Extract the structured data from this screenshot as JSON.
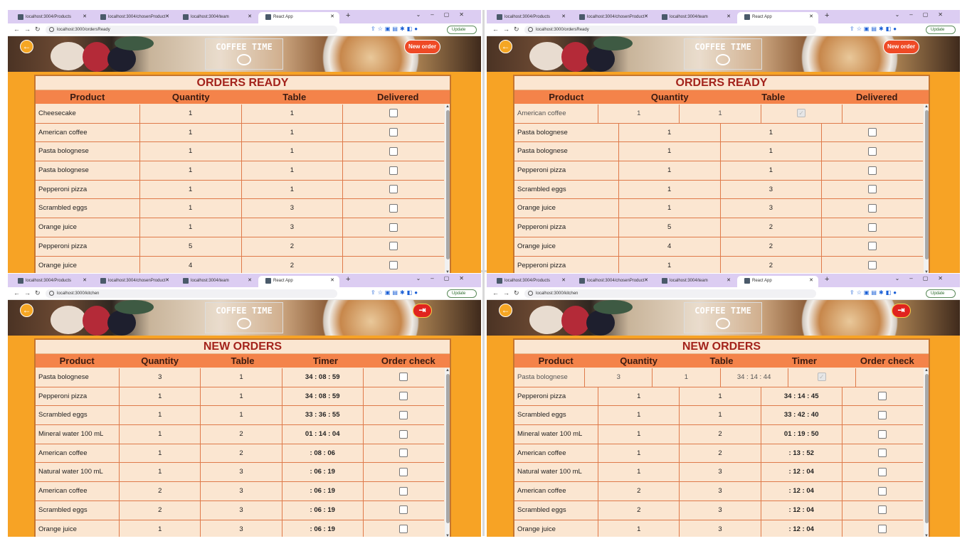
{
  "browser": {
    "tabs": [
      "localhost:3004/Products",
      "localhost:3004/chosenProduct",
      "localhost:3004/team",
      "React App"
    ],
    "update_label": "Update"
  },
  "logo_text": "COFFEE TIME",
  "top_left": {
    "url": "localhost:3000/ordersReady",
    "new_order_label": "New order",
    "title": "ORDERS READY",
    "headers": [
      "Product",
      "Quantity",
      "Table",
      "Delivered"
    ],
    "rows": [
      [
        "Cheesecake",
        "1",
        "1"
      ],
      [
        "American coffee",
        "1",
        "1"
      ],
      [
        "Pasta bolognese",
        "1",
        "1"
      ],
      [
        "Pasta bolognese",
        "1",
        "1"
      ],
      [
        "Pepperoni pizza",
        "1",
        "1"
      ],
      [
        "Scrambled eggs",
        "1",
        "3"
      ],
      [
        "Orange juice",
        "1",
        "3"
      ],
      [
        "Pepperoni pizza",
        "5",
        "2"
      ],
      [
        "Orange juice",
        "4",
        "2"
      ]
    ]
  },
  "top_right": {
    "url": "localhost:3000/ordersReady",
    "new_order_label": "New order",
    "title": "ORDERS READY",
    "headers": [
      "Product",
      "Quantity",
      "Table",
      "Delivered"
    ],
    "done_row": [
      "American coffee",
      "1",
      "1"
    ],
    "rows": [
      [
        "Pasta bolognese",
        "1",
        "1"
      ],
      [
        "Pasta bolognese",
        "1",
        "1"
      ],
      [
        "Pepperoni pizza",
        "1",
        "1"
      ],
      [
        "Scrambled eggs",
        "1",
        "3"
      ],
      [
        "Orange juice",
        "1",
        "3"
      ],
      [
        "Pepperoni pizza",
        "5",
        "2"
      ],
      [
        "Orange juice",
        "4",
        "2"
      ],
      [
        "Pepperoni pizza",
        "1",
        "2"
      ]
    ]
  },
  "bottom_left": {
    "url": "localhost:3000/kitchen",
    "title": "NEW ORDERS",
    "headers": [
      "Product",
      "Quantity",
      "Table",
      "Timer",
      "Order check"
    ],
    "rows": [
      [
        "Pasta bolognese",
        "3",
        "1",
        "34 : 08 : 59"
      ],
      [
        "Pepperoni pizza",
        "1",
        "1",
        "34 : 08 : 59"
      ],
      [
        "Scrambled eggs",
        "1",
        "1",
        "33 : 36 : 55"
      ],
      [
        "Mineral water 100 mL",
        "1",
        "2",
        "01 : 14 : 04"
      ],
      [
        "American coffee",
        "1",
        "2",
        ": 08 : 06"
      ],
      [
        "Natural water 100 mL",
        "1",
        "3",
        ": 06 : 19"
      ],
      [
        "American coffee",
        "2",
        "3",
        ": 06 : 19"
      ],
      [
        "Scrambled eggs",
        "2",
        "3",
        ": 06 : 19"
      ],
      [
        "Orange juice",
        "1",
        "3",
        ": 06 : 19"
      ]
    ]
  },
  "bottom_right": {
    "url": "localhost:3000/kitchen",
    "title": "NEW ORDERS",
    "headers": [
      "Product",
      "Quantity",
      "Table",
      "Timer",
      "Order check"
    ],
    "done_row": [
      "Pasta bolognese",
      "3",
      "1",
      "34 : 14 : 44"
    ],
    "rows": [
      [
        "Pepperoni pizza",
        "1",
        "1",
        "34 : 14 : 45"
      ],
      [
        "Scrambled eggs",
        "1",
        "1",
        "33 : 42 : 40"
      ],
      [
        "Mineral water 100 mL",
        "1",
        "2",
        "01 : 19 : 50"
      ],
      [
        "American coffee",
        "1",
        "2",
        ": 13 : 52"
      ],
      [
        "Natural water 100 mL",
        "1",
        "3",
        ": 12 : 04"
      ],
      [
        "American coffee",
        "2",
        "3",
        ": 12 : 04"
      ],
      [
        "Scrambled eggs",
        "2",
        "3",
        ": 12 : 04"
      ],
      [
        "Orange juice",
        "1",
        "3",
        ": 12 : 04"
      ]
    ]
  }
}
